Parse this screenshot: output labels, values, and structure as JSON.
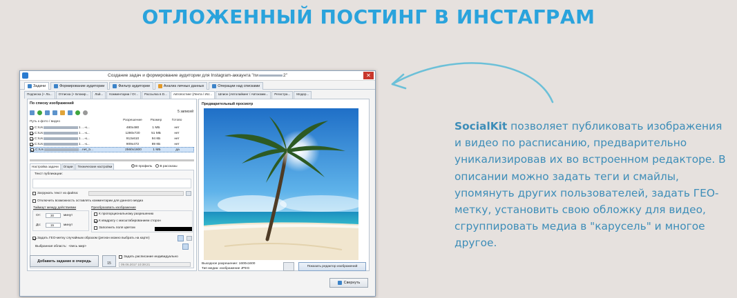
{
  "headline": "ОТЛОЖЕННЫЙ ПОСТИНГ В ИНСТАГРАМ",
  "description": {
    "brand": "SocialKit",
    "text": " позволяет публиковать изображения и видео по расписанию, предварительно уникализировав их во встроенном редакторе. В описании можно задать теги и смайлы, упомянуть других пользователей, задать ГЕО-метку, установить свою обложку для видео, сгруппировать медиа в \"карусель\" и многое другое."
  },
  "colors": {
    "headline": "#2aa3dc",
    "description": "#3d8db8",
    "arrow": "#6cc0d8",
    "close": "#c8372d"
  },
  "window": {
    "title": "Создание задач и формирование аудитории для Instagram-аккаунта \"пи",
    "title_tail": "2\"",
    "close_glyph": "✕",
    "main_tabs": [
      {
        "label": "Задачи",
        "icon": "tasks-icon"
      },
      {
        "label": "Формирование аудитории",
        "icon": "audience-icon"
      },
      {
        "label": "Фильтр аудитории",
        "icon": "filter-icon"
      },
      {
        "label": "Анализ личных данных",
        "icon": "analysis-icon"
      },
      {
        "label": "Операции над списками",
        "icon": "lists-icon"
      }
    ],
    "sub_tabs": [
      "Подписка (+ Ла...",
      "Отписка (+ Блокир...",
      "Лай...",
      "Комментарии / От...",
      "Рассылка в D...",
      "Автопостинг (Лента / Исг...",
      "Шпион (Автолайкинг / Автокомм...",
      "Регистра...",
      "Модер..."
    ],
    "left": {
      "header": "По списку изображений",
      "count": "5 записей",
      "columns": {
        "path": "Путь к фото / видео",
        "res": "Разрешение",
        "size": "Размер",
        "ready": "Готово"
      },
      "rows": [
        {
          "path_start": "C:\\Us",
          "path_end": "1 ...-к...",
          "res": "480x480",
          "size": "1 МБ",
          "ready": "нет"
        },
        {
          "path_start": "C:\\Us",
          "path_end": "1 ...-к...",
          "res": "1280x720",
          "size": "51 МБ",
          "ready": "нет"
        },
        {
          "path_start": "C:\\Us",
          "path_end": "1 ...-к...",
          "res": "913x610",
          "size": "94 КБ",
          "ready": "нет"
        },
        {
          "path_start": "C:\\Us",
          "path_end": "1 ...-к...",
          "res": "909x472",
          "size": "89 КБ",
          "ready": "нет"
        },
        {
          "path_start": "C:\\Us",
          "path_end": "...net_b...",
          "res": "2560x1600",
          "size": "1 МБ",
          "ready": "да"
        }
      ],
      "settings_tabs": [
        "Настройка задачи",
        "Опции",
        "Технические настройки"
      ],
      "radio_profile": "В профиль",
      "radio_stories": "В рассказы",
      "pub_text_label": "Текст публикации:",
      "load_text_label": "Загружать текст из файла:",
      "disable_comments_label": "Отключить возможность оставлять комментарии для данного медиа",
      "timeout_label": "Таймаут между действиями",
      "timeout_from_label": "От:",
      "timeout_from": "30",
      "timeout_to_label": "До:",
      "timeout_to": "15",
      "minutes": "минут",
      "transform_label": "Преобразовать изображение",
      "opt_proportional": "К пропорциональному разрешению",
      "opt_square": "К квадрату с масштабированием сторон",
      "opt_fill": "Заполнить поля цветом",
      "geo_label": "Задать ГЕО-метку случайным образом (регион можно выбрать на карте)",
      "region_label": "Выбранная область:",
      "region_value": "<весь мир>",
      "add_button": "Добавить задание в очередь",
      "cal_label": "15",
      "individual_label": "Задать расписание индивидуально",
      "date_value": "09.06.2017 10:39:21"
    },
    "right": {
      "header": "Предварительный просмотр",
      "res_label": "Выходное разрешение: 1600x1600",
      "type_label": "Тип медиа: изображение JPEG",
      "edit_button": "Показать редактор изображений"
    },
    "minimize_button": "Свернуть"
  }
}
